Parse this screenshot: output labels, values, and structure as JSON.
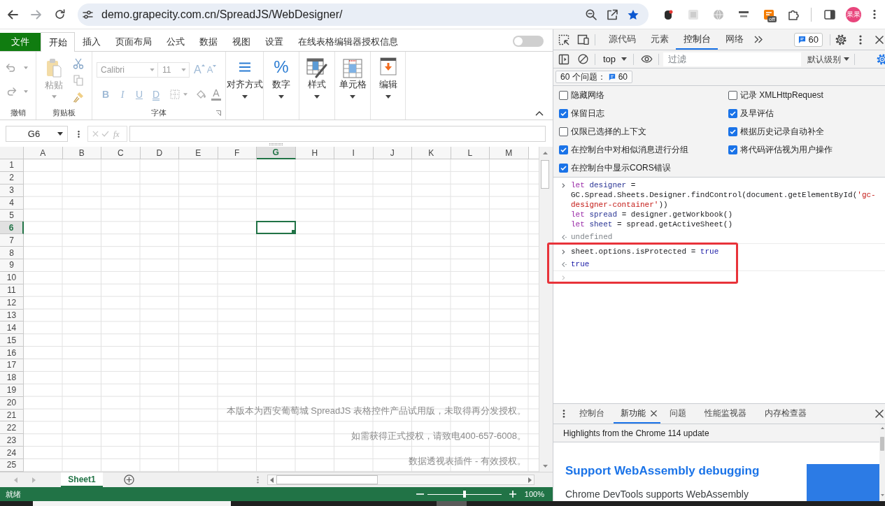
{
  "browser": {
    "url": "demo.grapecity.com.cn/SpreadJS/WebDesigner/",
    "bookmarked": true,
    "extensions": [
      {
        "kind": "bug"
      },
      {
        "kind": "tile"
      },
      {
        "kind": "globe"
      },
      {
        "kind": "logo"
      },
      {
        "kind": "square",
        "badge": "off"
      }
    ],
    "profile": "果果"
  },
  "designer": {
    "tabs": [
      {
        "label": "文件",
        "kind": "file",
        "selected": false
      },
      {
        "label": "开始",
        "kind": "tab",
        "selected": true
      },
      {
        "label": "插入",
        "kind": "tab",
        "selected": false
      },
      {
        "label": "页面布局",
        "kind": "tab",
        "selected": false
      },
      {
        "label": "公式",
        "kind": "tab",
        "selected": false
      },
      {
        "label": "数据",
        "kind": "tab",
        "selected": false
      },
      {
        "label": "视图",
        "kind": "tab",
        "selected": false
      },
      {
        "label": "设置",
        "kind": "tab",
        "selected": false
      },
      {
        "label": "在线表格编辑器授权信息",
        "kind": "tab",
        "selected": false
      }
    ],
    "toggle": {
      "on": false
    },
    "ribbon": [
      {
        "kind": "undo",
        "label": "撤销",
        "disabled": true
      },
      {
        "kind": "clipboard",
        "label": "剪贴板",
        "paste": "粘贴",
        "disabled": true
      },
      {
        "kind": "font",
        "label": "字体",
        "disabled": true,
        "family": "Calibri",
        "size": "11",
        "grow": "A",
        "shrink": "A",
        "styles": [
          {
            "label": "B",
            "kind": "bold"
          },
          {
            "label": "I",
            "kind": "italic"
          },
          {
            "label": "U",
            "kind": "underline"
          },
          {
            "label": "D",
            "kind": "double"
          }
        ],
        "font_color_button": "A"
      },
      {
        "kind": "align",
        "label": "对齐方式"
      },
      {
        "kind": "number",
        "label": "数字",
        "glyph": "%"
      },
      {
        "kind": "styles",
        "label": "样式"
      },
      {
        "kind": "cells",
        "label": "单元格"
      },
      {
        "kind": "edit",
        "label": "编辑"
      }
    ],
    "name_box": "G6",
    "fx": "fx",
    "columns": [
      {
        "label": "A",
        "selected": false
      },
      {
        "label": "B",
        "selected": false
      },
      {
        "label": "C",
        "selected": false
      },
      {
        "label": "D",
        "selected": false
      },
      {
        "label": "E",
        "selected": false
      },
      {
        "label": "F",
        "selected": false
      },
      {
        "label": "G",
        "selected": true
      },
      {
        "label": "H",
        "selected": false
      },
      {
        "label": "I",
        "selected": false
      },
      {
        "label": "J",
        "selected": false
      },
      {
        "label": "K",
        "selected": false
      },
      {
        "label": "L",
        "selected": false
      },
      {
        "label": "M",
        "selected": false
      }
    ],
    "rows": [
      {
        "label": "1",
        "selected": false
      },
      {
        "label": "2",
        "selected": false
      },
      {
        "label": "3",
        "selected": false
      },
      {
        "label": "4",
        "selected": false
      },
      {
        "label": "5",
        "selected": false
      },
      {
        "label": "6",
        "selected": true
      },
      {
        "label": "7",
        "selected": false
      },
      {
        "label": "8",
        "selected": false
      },
      {
        "label": "9",
        "selected": false
      },
      {
        "label": "10",
        "selected": false
      },
      {
        "label": "11",
        "selected": false
      },
      {
        "label": "12",
        "selected": false
      },
      {
        "label": "13",
        "selected": false
      },
      {
        "label": "14",
        "selected": false
      },
      {
        "label": "15",
        "selected": false
      },
      {
        "label": "16",
        "selected": false
      },
      {
        "label": "17",
        "selected": false
      },
      {
        "label": "18",
        "selected": false
      },
      {
        "label": "19",
        "selected": false
      },
      {
        "label": "20",
        "selected": false
      },
      {
        "label": "21",
        "selected": false
      },
      {
        "label": "22",
        "selected": false
      },
      {
        "label": "23",
        "selected": false
      },
      {
        "label": "24",
        "selected": false
      },
      {
        "label": "25",
        "selected": false
      }
    ],
    "notices": [
      "本版本为西安葡萄城 SpreadJS 表格控件产品试用版，未取得再分发授权。",
      "如需获得正式授权，请致电400-657-6008。",
      "数据透视表插件 - 有效授权。"
    ],
    "sheets": [
      {
        "label": "Sheet1",
        "selected": true
      }
    ],
    "status": "就绪",
    "zoom": {
      "level": 0.5,
      "reading": "100%"
    }
  },
  "devtools": {
    "tabs": [
      {
        "label": "源代码",
        "selected": false
      },
      {
        "label": "元素",
        "selected": false
      },
      {
        "label": "控制台",
        "selected": true
      },
      {
        "label": "网络",
        "selected": false
      }
    ],
    "issue_badge": "60",
    "context": "top",
    "filter": {
      "placeholder": "过滤"
    },
    "log_level": "默认级别",
    "issues": {
      "label": "60 个问题：",
      "count": "60"
    },
    "settings": [
      {
        "label": "隐藏网络",
        "checked": false
      },
      {
        "label": "记录 XMLHttpRequest",
        "checked": false
      },
      {
        "label": "保留日志",
        "checked": true
      },
      {
        "label": "及早评估",
        "checked": true
      },
      {
        "label": "仅限已选择的上下文",
        "checked": false
      },
      {
        "label": "根据历史记录自动补全",
        "checked": true
      },
      {
        "label": "在控制台中对相似消息进行分组",
        "checked": true
      },
      {
        "label": "将代码评估视为用户操作",
        "checked": true
      },
      {
        "label": "在控制台中显示CORS错误",
        "checked": true
      }
    ],
    "console": [
      {
        "kind": "input",
        "highlighted": false,
        "lines": [
          [
            {
              "text": "let",
              "kind": "keyword"
            },
            {
              "text": " designer",
              "kind": "variable"
            },
            {
              "text": " =",
              "kind": "plain"
            }
          ],
          [
            {
              "text": "GC.Spread.Sheets.Designer.findControl(document.getElementById(",
              "kind": "plain"
            },
            {
              "text": "'gc-",
              "kind": "string"
            }
          ],
          [
            {
              "text": "designer-container'",
              "kind": "string"
            },
            {
              "text": "))",
              "kind": "plain"
            }
          ],
          [
            {
              "text": "let",
              "kind": "keyword"
            },
            {
              "text": " spread",
              "kind": "variable"
            },
            {
              "text": " = designer.getWorkbook()",
              "kind": "plain"
            }
          ],
          [
            {
              "text": "let",
              "kind": "keyword"
            },
            {
              "text": " sheet",
              "kind": "variable"
            },
            {
              "text": " = spread.getActiveSheet()",
              "kind": "plain"
            }
          ]
        ]
      },
      {
        "kind": "result",
        "highlighted": false,
        "lines": [
          [
            {
              "text": "undefined",
              "kind": "muted"
            }
          ]
        ]
      },
      {
        "kind": "input",
        "highlighted": true,
        "lines": [
          [
            {
              "text": "sheet.options.isProtected = ",
              "kind": "plain"
            },
            {
              "text": "true",
              "kind": "literal"
            }
          ]
        ]
      },
      {
        "kind": "result",
        "highlighted": true,
        "lines": [
          [
            {
              "text": "true",
              "kind": "literal"
            }
          ]
        ]
      },
      {
        "kind": "prompt",
        "highlighted": true
      }
    ],
    "drawer": {
      "tabs": [
        {
          "label": "控制台",
          "selected": false,
          "closable": false
        },
        {
          "label": "新功能",
          "selected": true,
          "closable": true
        },
        {
          "label": "问题",
          "selected": false,
          "closable": false
        },
        {
          "label": "性能监视器",
          "selected": false,
          "closable": false
        },
        {
          "label": "内存检查器",
          "selected": false,
          "closable": false
        }
      ],
      "banner": "Highlights from the Chrome 114 update",
      "heading": "Support WebAssembly debugging",
      "body": "Chrome DevTools supports WebAssembly"
    }
  }
}
